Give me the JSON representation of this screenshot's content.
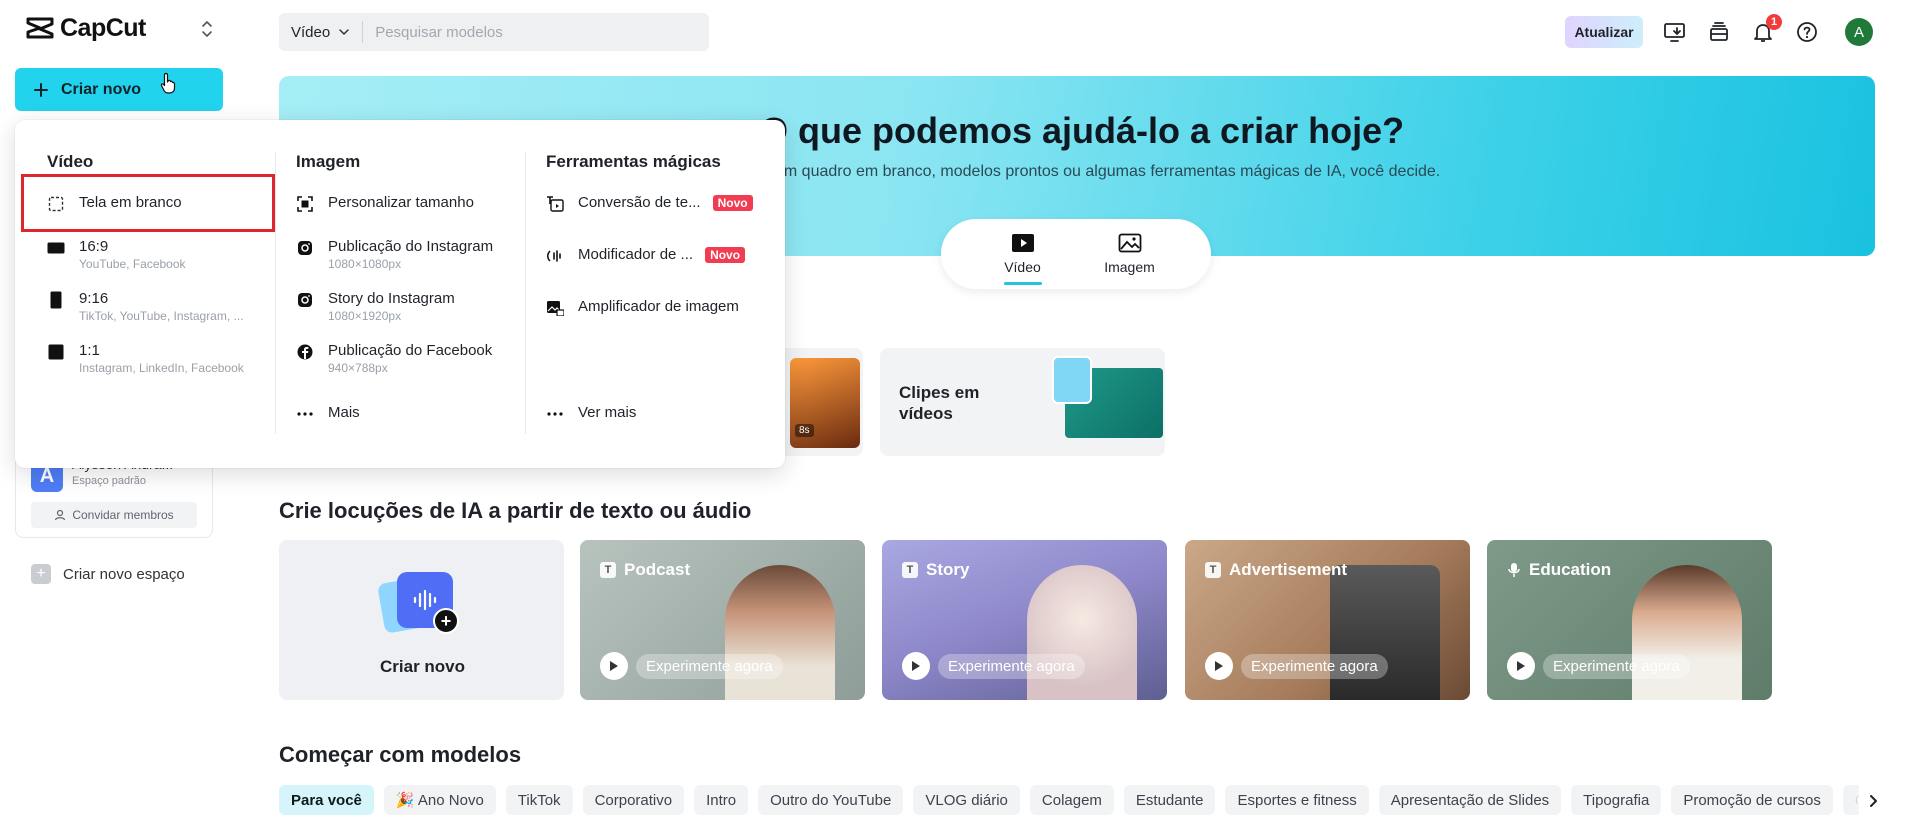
{
  "sidebar": {
    "brand": "CapCut",
    "create_button": "Criar novo",
    "member_name": "Alysson Andra...",
    "member_space": "Espaço padrão",
    "member_initial": "A",
    "invite_button": "Convidar membros",
    "new_space": "Criar novo espaço"
  },
  "topbar": {
    "search_type": "Vídeo",
    "search_placeholder": "Pesquisar modelos",
    "upgrade": "Atualizar",
    "notification_count": "1",
    "user_initial": "A"
  },
  "hero": {
    "title": "O que podemos ajudá-lo a criar hoje?",
    "subtitle": "um quadro em branco, modelos prontos ou algumas ferramentas mágicas de IA, você decide.",
    "tabs": [
      {
        "label": "Vídeo",
        "active": true
      },
      {
        "label": "Imagem",
        "active": false
      }
    ]
  },
  "feature_cards": {
    "partial_badge": "8s",
    "clips_title": "Clipes em vídeos"
  },
  "voice_section": {
    "heading": "Crie locuções de IA a partir de texto ou áudio",
    "create_label": "Criar novo",
    "try_label": "Experimente agora",
    "cards": [
      {
        "label": "Podcast"
      },
      {
        "label": "Story"
      },
      {
        "label": "Advertisement"
      },
      {
        "label": "Education"
      }
    ]
  },
  "templates": {
    "heading": "Começar com modelos",
    "chips": [
      "Para você",
      "🎉 Ano Novo",
      "TikTok",
      "Corporativo",
      "Intro",
      "Outro do YouTube",
      "VLOG diário",
      "Colagem",
      "Estudante",
      "Esportes e fitness",
      "Apresentação de Slides",
      "Tipografia",
      "Promoção de cursos",
      "Corp"
    ]
  },
  "dropdown": {
    "video": {
      "title": "Vídeo",
      "items": [
        {
          "label": "Tela em branco",
          "sub": ""
        },
        {
          "label": "16:9",
          "sub": "YouTube, Facebook"
        },
        {
          "label": "9:16",
          "sub": "TikTok, YouTube, Instagram, ..."
        },
        {
          "label": "1:1",
          "sub": "Instagram, LinkedIn, Facebook"
        }
      ]
    },
    "image": {
      "title": "Imagem",
      "items": [
        {
          "label": "Personalizar tamanho",
          "sub": ""
        },
        {
          "label": "Publicação do Instagram",
          "sub": "1080×1080px"
        },
        {
          "label": "Story do Instagram",
          "sub": "1080×1920px"
        },
        {
          "label": "Publicação do Facebook",
          "sub": "940×788px"
        },
        {
          "label": "Mais",
          "sub": ""
        }
      ]
    },
    "magic": {
      "title": "Ferramentas mágicas",
      "badge": "Novo",
      "items": [
        {
          "label": "Conversão de te...",
          "sub": ""
        },
        {
          "label": "Modificador de ...",
          "sub": ""
        },
        {
          "label": "Amplificador de imagem",
          "sub": ""
        },
        {
          "label": "Ver mais",
          "sub": ""
        }
      ]
    }
  },
  "colors": {
    "accent": "#22d3ee",
    "badge_red": "#f23c52",
    "highlight_red": "#e0252f"
  }
}
